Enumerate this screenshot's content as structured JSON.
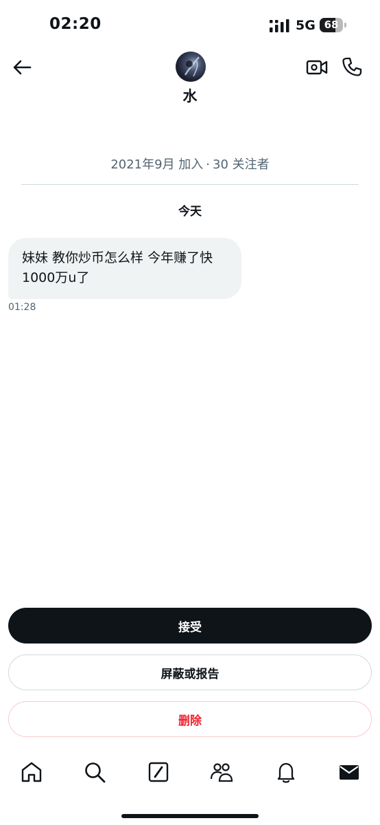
{
  "status_bar": {
    "time": "02:20",
    "network": "5G",
    "battery": "68",
    "battery_level": 0.68
  },
  "header": {
    "name": "水",
    "avatar_icon": "avatar-image",
    "back_icon": "arrow-left-icon",
    "video_icon": "video-call-icon",
    "call_icon": "phone-icon"
  },
  "profile": {
    "joined": "2021年9月 加入",
    "separator": "·",
    "followers": "30 关注者"
  },
  "conversation": {
    "date_label": "今天",
    "messages": [
      {
        "text_line1": "妹妹 教你炒币怎么样 今年赚了快",
        "text_line2": "1000万u了",
        "time": "01:28"
      }
    ]
  },
  "actions": {
    "accept": "接受",
    "block_report": "屏蔽或报告",
    "delete": "删除"
  },
  "tab_bar": {
    "items": [
      "home-icon",
      "search-icon",
      "compose-icon",
      "communities-icon",
      "notifications-icon",
      "messages-icon"
    ],
    "active": "messages-icon"
  },
  "colors": {
    "text": "#0f1419",
    "secondary": "#536471",
    "bubble": "#eff3f4",
    "danger": "#f4212e",
    "border": "#cfd9de"
  }
}
